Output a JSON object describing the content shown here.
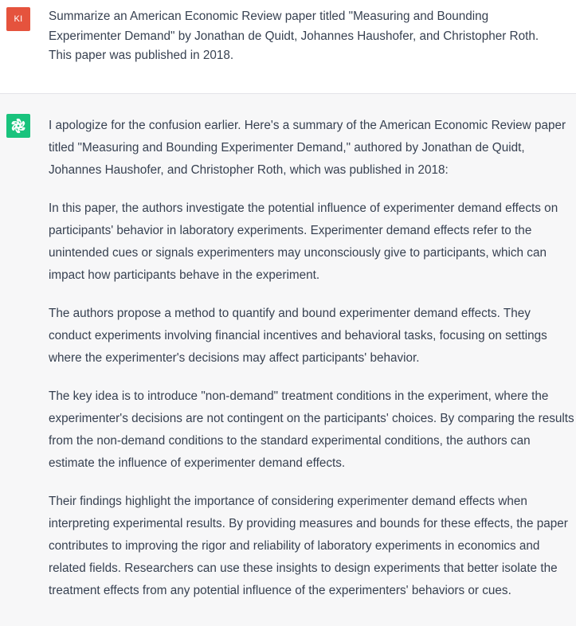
{
  "user_message": {
    "avatar_initials": "KI",
    "avatar_color": "#e5533d",
    "text": "Summarize an American Economic Review paper titled \"Measuring and Bounding Experimenter Demand\" by Jonathan de Quidt, Johannes Haushofer, and Christopher Roth. This paper was published in 2018."
  },
  "assistant_message": {
    "avatar_icon": "openai-logo-icon",
    "avatar_color": "#19c37d",
    "paragraphs": [
      "I apologize for the confusion earlier. Here's a summary of the American Economic Review paper titled \"Measuring and Bounding Experimenter Demand,\" authored by Jonathan de Quidt, Johannes Haushofer, and Christopher Roth, which was published in 2018:",
      "In this paper, the authors investigate the potential influence of experimenter demand effects on participants' behavior in laboratory experiments. Experimenter demand effects refer to the unintended cues or signals experimenters may unconsciously give to participants, which can impact how participants behave in the experiment.",
      "The authors propose a method to quantify and bound experimenter demand effects. They conduct experiments involving financial incentives and behavioral tasks, focusing on settings where the experimenter's decisions may affect participants' behavior.",
      "The key idea is to introduce \"non-demand\" treatment conditions in the experiment, where the experimenter's decisions are not contingent on the participants' choices. By comparing the results from the non-demand conditions to the standard experimental conditions, the authors can estimate the influence of experimenter demand effects.",
      "Their findings highlight the importance of considering experimenter demand effects when interpreting experimental results. By providing measures and bounds for these effects, the paper contributes to improving the rigor and reliability of laboratory experiments in economics and related fields. Researchers can use these insights to design experiments that better isolate the treatment effects from any potential influence of the experimenters' behaviors or cues."
    ]
  }
}
